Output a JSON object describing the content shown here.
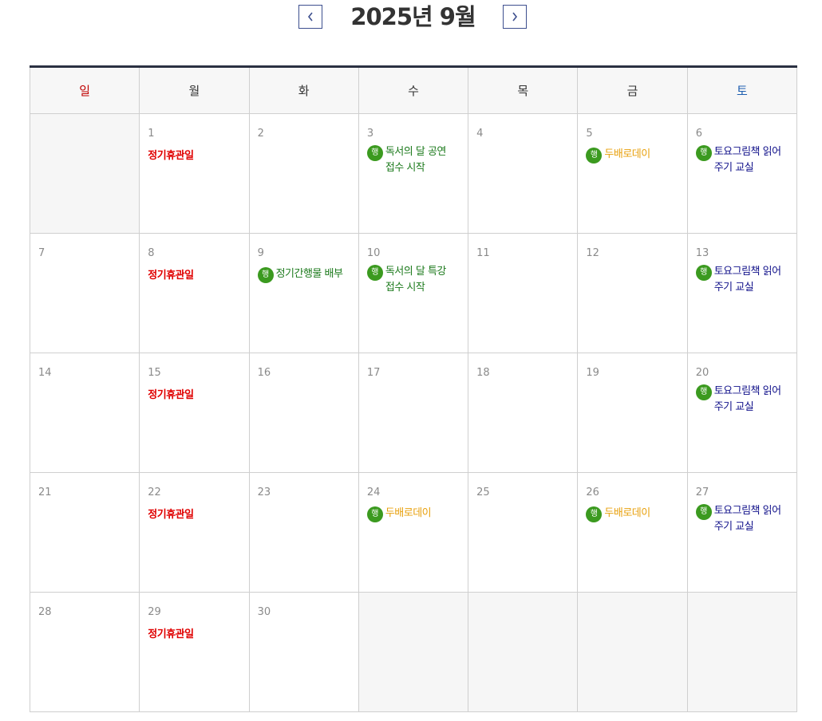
{
  "header": {
    "title": "2025년 9월",
    "prev_icon": "chevron-left-icon",
    "next_icon": "chevron-right-icon"
  },
  "weekdays": [
    "일",
    "월",
    "화",
    "수",
    "목",
    "금",
    "토"
  ],
  "badge_label": "행",
  "closed_label": "정기휴관일",
  "events": {
    "d3": "독서의 달 공연 접수 시작",
    "d5": "두배로데이",
    "d6": "토요그림책 읽어주기 교실",
    "d9": "정기간행물 배부",
    "d10": "독서의 달 특강 접수 시작",
    "d13": "토요그림책 읽어주기 교실",
    "d20": "토요그림책 읽어주기 교실",
    "d24": "두배로데이",
    "d26": "두배로데이",
    "d27": "토요그림책 읽어주기 교실"
  },
  "days": [
    "1",
    "2",
    "3",
    "4",
    "5",
    "6",
    "7",
    "8",
    "9",
    "10",
    "11",
    "12",
    "13",
    "14",
    "15",
    "16",
    "17",
    "18",
    "19",
    "20",
    "21",
    "22",
    "23",
    "24",
    "25",
    "26",
    "27",
    "28",
    "29",
    "30"
  ],
  "colors": {
    "closed": "#e00000",
    "badge": "#3b9a1f",
    "green_event": "#1c7a1c",
    "orange_event": "#e8a00c",
    "navy_event": "#10108a",
    "sunday": "#c00000",
    "saturday": "#1f5fb0"
  }
}
